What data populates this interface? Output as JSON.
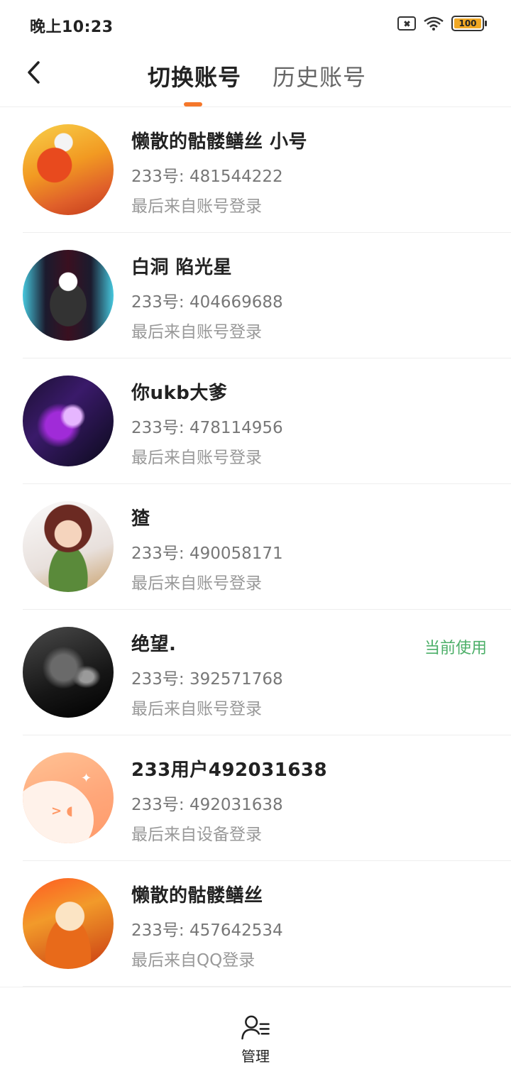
{
  "status_bar": {
    "time": "晚上10:23",
    "battery_level": "100",
    "icons": [
      "sim-off-icon",
      "wifi-icon",
      "battery-icon"
    ]
  },
  "header": {
    "tabs": [
      {
        "label": "切换账号",
        "active": true
      },
      {
        "label": "历史账号",
        "active": false
      }
    ],
    "accent_color": "#f5772a"
  },
  "accounts": [
    {
      "name": "懒散的骷髅鳝丝 小号",
      "id": "233号: 481544222",
      "source": "最后来自账号登录",
      "current": ""
    },
    {
      "name": "白洞 陷光星",
      "id": "233号: 404669688",
      "source": "最后来自账号登录",
      "current": ""
    },
    {
      "name": "你ukb大爹",
      "id": "233号: 478114956",
      "source": "最后来自账号登录",
      "current": ""
    },
    {
      "name": "猹",
      "id": "233号: 490058171",
      "source": "最后来自账号登录",
      "current": ""
    },
    {
      "name": "绝望.",
      "id": "233号: 392571768",
      "source": "最后来自账号登录",
      "current": "当前使用"
    },
    {
      "name": "233用户492031638",
      "id": "233号: 492031638",
      "source": "最后来自设备登录",
      "current": ""
    },
    {
      "name": "懒散的骷髅鳝丝",
      "id": "233号: 457642534",
      "source": "最后来自QQ登录",
      "current": ""
    }
  ],
  "current_color": "#4caf68",
  "bottom": {
    "manage_label": "管理",
    "manage_icon": "user-manage-icon"
  }
}
